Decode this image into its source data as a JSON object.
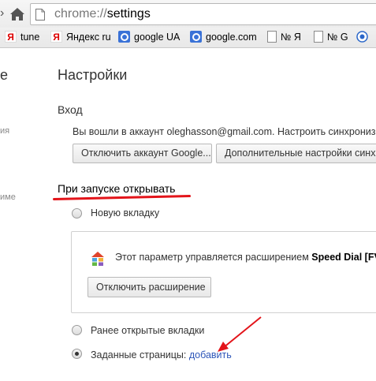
{
  "toolbar": {
    "url_scheme": "chrome://",
    "url_path": "settings"
  },
  "bookmarks": [
    {
      "icon": "yandex-icon",
      "label": "tune"
    },
    {
      "icon": "yandex-icon",
      "label": "Яндекс ru"
    },
    {
      "icon": "google-icon",
      "label": "google UA"
    },
    {
      "icon": "google-icon",
      "label": "google.com"
    },
    {
      "icon": "page-icon",
      "label": "№ Я"
    },
    {
      "icon": "page-icon",
      "label": "№ G"
    },
    {
      "icon": "globe-icon",
      "label": ""
    }
  ],
  "sidebar": {
    "fragment_title": "e",
    "fragment_items": [
      "ия",
      "име"
    ]
  },
  "settings": {
    "title": "Настройки",
    "signin": {
      "heading": "Вход",
      "text": "Вы вошли в аккаунт oleghasson@gmail.com. Настроить синхронизаци",
      "disconnect_label": "Отключить аккаунт Google...",
      "advanced_label": "Дополнительные настройки синхро"
    },
    "startup": {
      "heading": "При запуске открывать",
      "option_new_tab": "Новую вкладку",
      "extension_message_prefix": "Этот параметр управляется расширением",
      "extension_name": "Speed Dial [FVD]",
      "disable_extension_label": "Отключить расширение",
      "option_continue": "Ранее открытые вкладки",
      "option_pages": "Заданные страницы:",
      "pages_link": "добавить",
      "selected_option": "option_pages"
    }
  },
  "colors": {
    "annotation_red": "#e3141a",
    "link_blue": "#2f57b9"
  }
}
